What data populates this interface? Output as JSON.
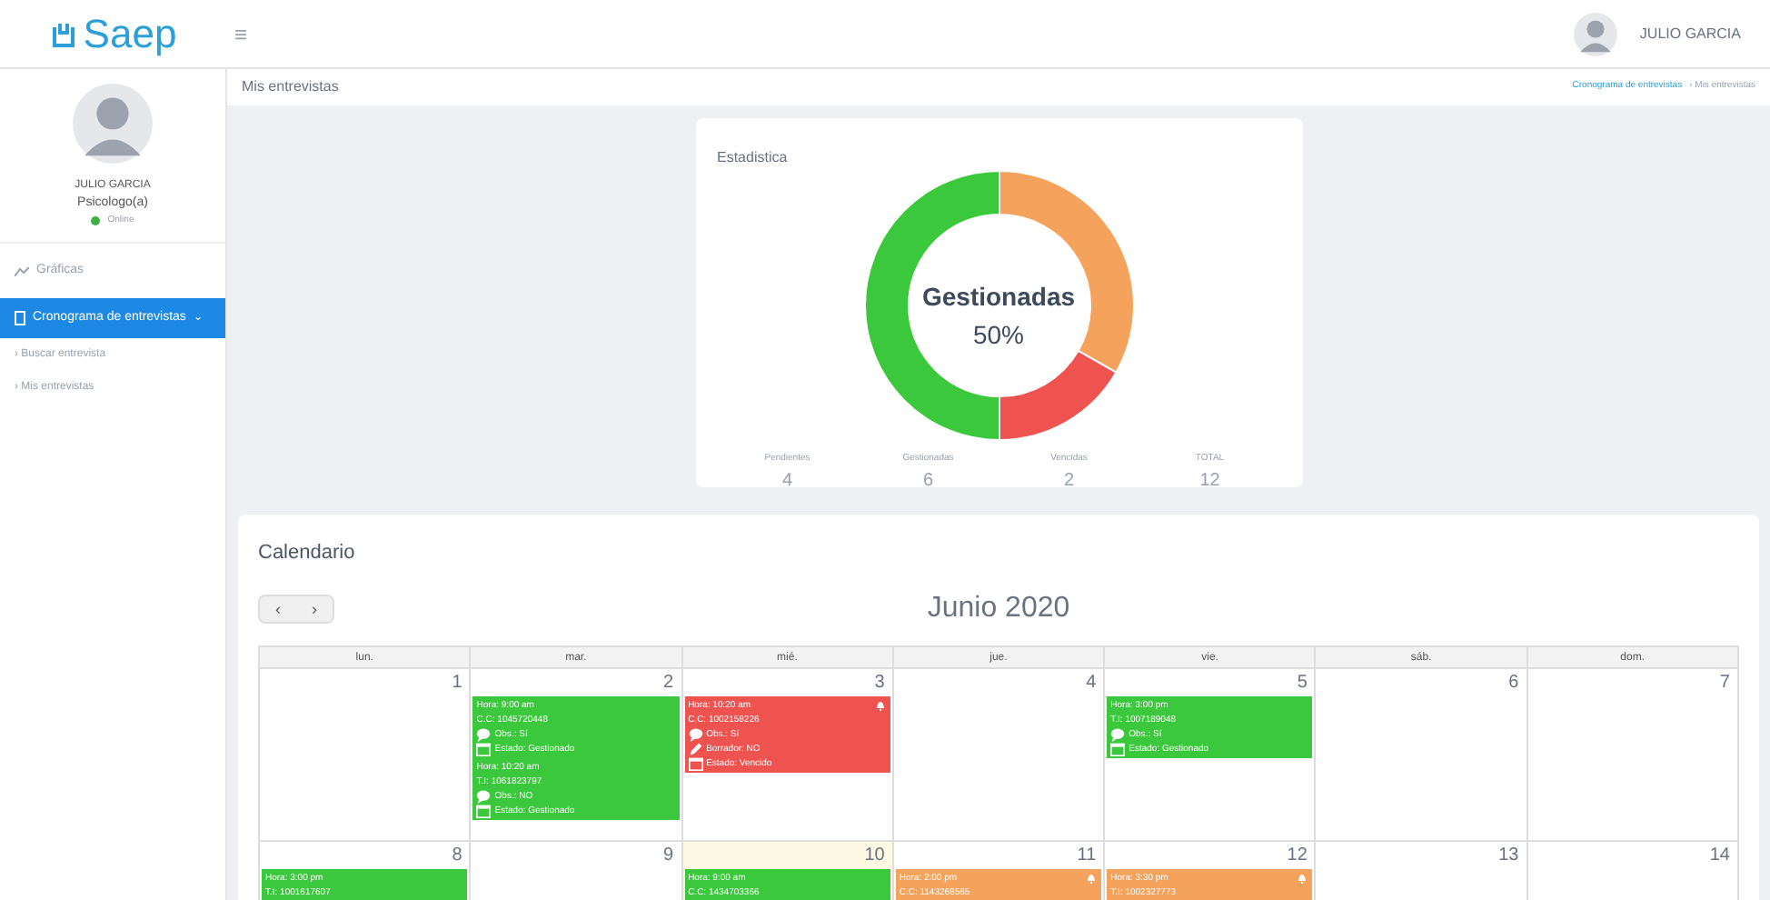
{
  "header": {
    "logo": "Saep",
    "menu_glyph": "≡",
    "user_name": "JULIO GARCIA"
  },
  "sidebar": {
    "user_name": "JULIO GARCIA",
    "role": "Psicologo(a)",
    "status": "Online",
    "items": [
      {
        "label": "Gráficas",
        "selected": false
      },
      {
        "label": "Cronograma de entrevistas",
        "selected": true,
        "expanded": true,
        "caret": "⌄",
        "children": [
          {
            "bullet": "›",
            "label": "Buscar entrevista",
            "selected": false
          },
          {
            "bullet": "›",
            "label": "Mis entrevistas",
            "selected": false
          }
        ]
      }
    ]
  },
  "page": {
    "title": "Mis entrevistas",
    "breadcrumb": [
      "Cronograma de entrevistas",
      "Mis entrevistas"
    ],
    "separator": "›"
  },
  "stats": {
    "title": "Estadistica",
    "center_label": "Gestionadas",
    "center_value": "50%",
    "chart_data": {
      "type": "donut",
      "values": [
        33.3,
        50,
        16.7
      ],
      "colors": [
        "#f5a35c",
        "#3cc83c",
        "#ef5350"
      ]
    },
    "counts": [
      {
        "label": "Pendientes",
        "value": "4"
      },
      {
        "label": "Gestionadas",
        "value": "6"
      },
      {
        "label": "Vencidas",
        "value": "2"
      },
      {
        "label": "TOTAL",
        "value": "12"
      }
    ]
  },
  "calendar": {
    "title": "Calendario",
    "prev": "‹",
    "next": "›",
    "month": "Junio 2020",
    "weekdays": [
      "lun.",
      "mar.",
      "mié.",
      "jue.",
      "vie.",
      "sáb.",
      "dom."
    ],
    "weeks": [
      [
        {
          "day": "1",
          "today": false
        },
        {
          "day": "2",
          "today": false,
          "events": [
            {
              "color": "#3cc83c",
              "bell": false,
              "lines": [
                {
                  "kind": "plain",
                  "text": "Hora: 9:00 am"
                },
                {
                  "kind": "plain",
                  "text": "C.C: 1045720448"
                },
                {
                  "kind": "obs",
                  "text": "Obs.: Sí"
                },
                {
                  "kind": "estado",
                  "text": "Estado: Gestionado"
                }
              ]
            },
            {
              "color": "#3cc83c",
              "bell": false,
              "lines": [
                {
                  "kind": "plain",
                  "text": "Hora: 10:20 am"
                },
                {
                  "kind": "plain",
                  "text": "T.I: 1061823797"
                },
                {
                  "kind": "obs",
                  "text": "Obs.: NO"
                },
                {
                  "kind": "estado",
                  "text": "Estado: Gestionado"
                }
              ]
            }
          ]
        },
        {
          "day": "3",
          "today": false,
          "events": [
            {
              "color": "#ef5350",
              "bell": true,
              "lines": [
                {
                  "kind": "plain",
                  "text": "Hora: 10:20 am"
                },
                {
                  "kind": "plain",
                  "text": "C.C: 1002158226"
                },
                {
                  "kind": "obs",
                  "text": "Obs.: Sí"
                },
                {
                  "kind": "borrador",
                  "text": "Borrador: NO"
                },
                {
                  "kind": "estado",
                  "text": "Estado: Vencido"
                }
              ]
            }
          ]
        },
        {
          "day": "4",
          "today": false
        },
        {
          "day": "5",
          "today": false,
          "events": [
            {
              "color": "#3cc83c",
              "bell": false,
              "lines": [
                {
                  "kind": "plain",
                  "text": "Hora: 3:00 pm"
                },
                {
                  "kind": "plain",
                  "text": "T.I: 1007189048"
                },
                {
                  "kind": "obs",
                  "text": "Obs.: Sí"
                },
                {
                  "kind": "estado",
                  "text": "Estado: Gestionado"
                }
              ]
            }
          ]
        },
        {
          "day": "6",
          "today": false
        },
        {
          "day": "7",
          "today": false
        }
      ],
      [
        {
          "day": "8",
          "today": false,
          "events": [
            {
              "color": "#3cc83c",
              "bell": false,
              "lines": [
                {
                  "kind": "plain",
                  "text": "Hora: 3:00 pm"
                },
                {
                  "kind": "plain",
                  "text": "T.I: 1001617607"
                }
              ]
            }
          ]
        },
        {
          "day": "9",
          "today": false
        },
        {
          "day": "10",
          "today": true,
          "events": [
            {
              "color": "#3cc83c",
              "bell": false,
              "lines": [
                {
                  "kind": "plain",
                  "text": "Hora: 9:00 am"
                },
                {
                  "kind": "plain",
                  "text": "C.C: 1434703366"
                }
              ]
            }
          ]
        },
        {
          "day": "11",
          "today": false,
          "events": [
            {
              "color": "#f5a35c",
              "bell": true,
              "lines": [
                {
                  "kind": "plain",
                  "text": "Hora: 2:00 pm"
                },
                {
                  "kind": "plain",
                  "text": "C.C: 1143268565"
                }
              ]
            }
          ]
        },
        {
          "day": "12",
          "today": false,
          "events": [
            {
              "color": "#f5a35c",
              "bell": true,
              "lines": [
                {
                  "kind": "plain",
                  "text": "Hora: 3:30 pm"
                },
                {
                  "kind": "plain",
                  "text": "T.I: 1002327773"
                }
              ]
            }
          ]
        },
        {
          "day": "13",
          "today": false
        },
        {
          "day": "14",
          "today": false
        }
      ]
    ]
  }
}
